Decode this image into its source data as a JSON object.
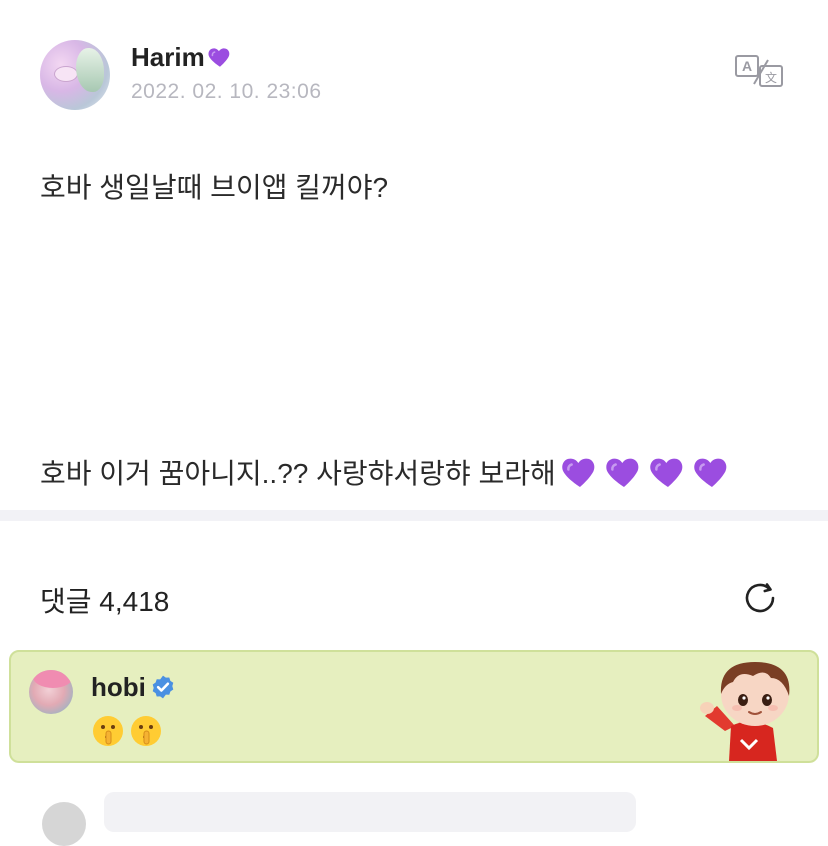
{
  "post": {
    "author": "Harim",
    "timestamp": "2022. 02. 10. 23:06",
    "line1": "호바 생일날때 브이앱 킬꺼야?",
    "line2": "호바 이거 꿈아니지..?? 사랑햐서랑햐 보라해",
    "heart_color": "#9b4de0"
  },
  "comments": {
    "label": "댓글 4,418",
    "highlight_bg": "#e6efbf",
    "top_comment": {
      "author": "hobi",
      "verified": true,
      "emojis": [
        "shushing-face",
        "shushing-face"
      ]
    }
  },
  "icons": {
    "translate": "translate-icon",
    "refresh": "refresh-icon",
    "verified": "verified-badge-icon"
  }
}
